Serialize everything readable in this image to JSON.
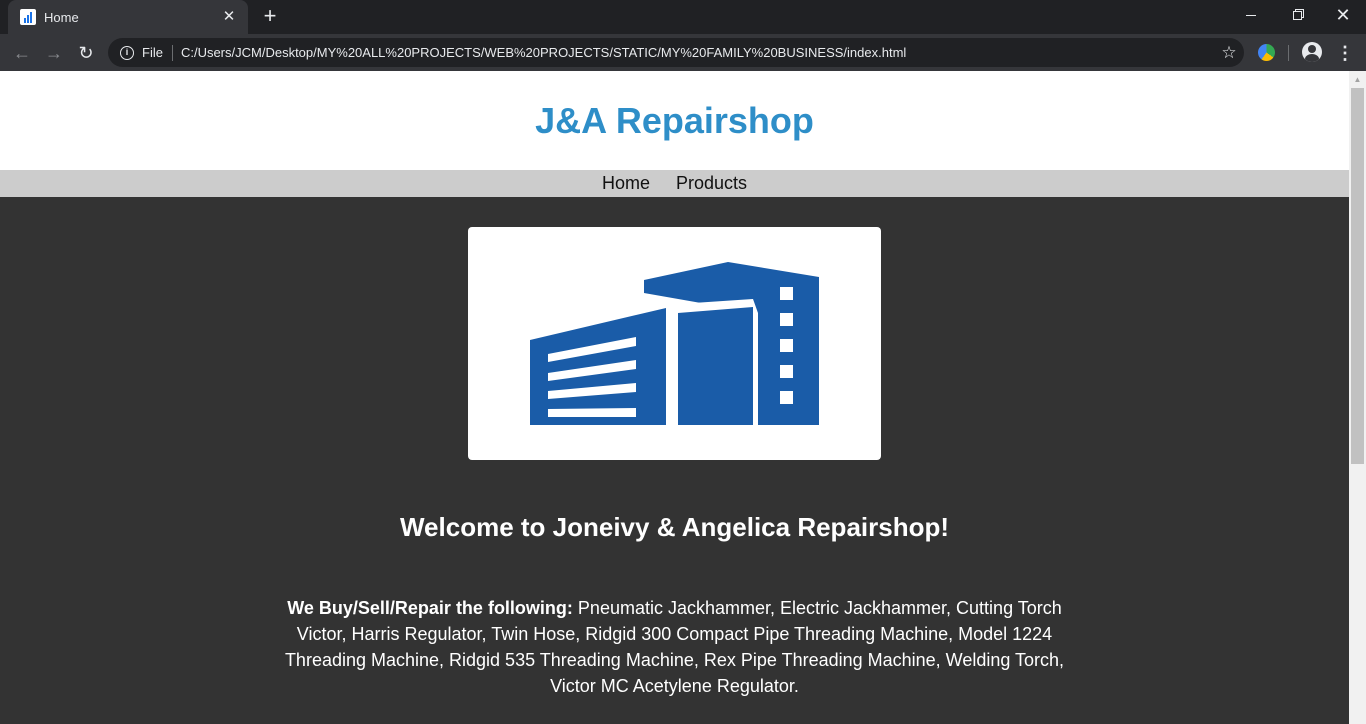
{
  "browser": {
    "tab_title": "Home",
    "omnibox_scheme": "File",
    "url": "C:/Users/JCM/Desktop/MY%20ALL%20PROJECTS/WEB%20PROJECTS/STATIC/MY%20FAMILY%20BUSINESS/index.html",
    "icons": [
      "site-favicon",
      "tab-close",
      "new-tab-plus",
      "back-arrow",
      "forward-arrow",
      "reload",
      "info-circle",
      "bookmark-star",
      "extension",
      "profile-avatar",
      "kebab-menu",
      "minimize",
      "maximize",
      "close"
    ]
  },
  "site": {
    "title": "J&A Repairshop",
    "nav": [
      "Home",
      "Products"
    ],
    "welcome": "Welcome to Joneivy & Angelica Repairshop!",
    "products_label": "We Buy/Sell/Repair the following:",
    "products_text": " Pneumatic Jackhammer, Electric Jackhammer, Cutting Torch Victor, Harris Regulator, Twin Hose, Ridgid 300 Compact Pipe Threading Machine, Model 1224 Threading Machine, Ridgid 535 Threading Machine, Rex Pipe Threading Machine, Welding Torch, Victor MC Acetylene Regulator."
  },
  "colors": {
    "title_blue": "#2e8ec8",
    "logo_blue": "#1a5ca8",
    "nav_bg": "#cccccc",
    "body_bg": "#333333"
  }
}
